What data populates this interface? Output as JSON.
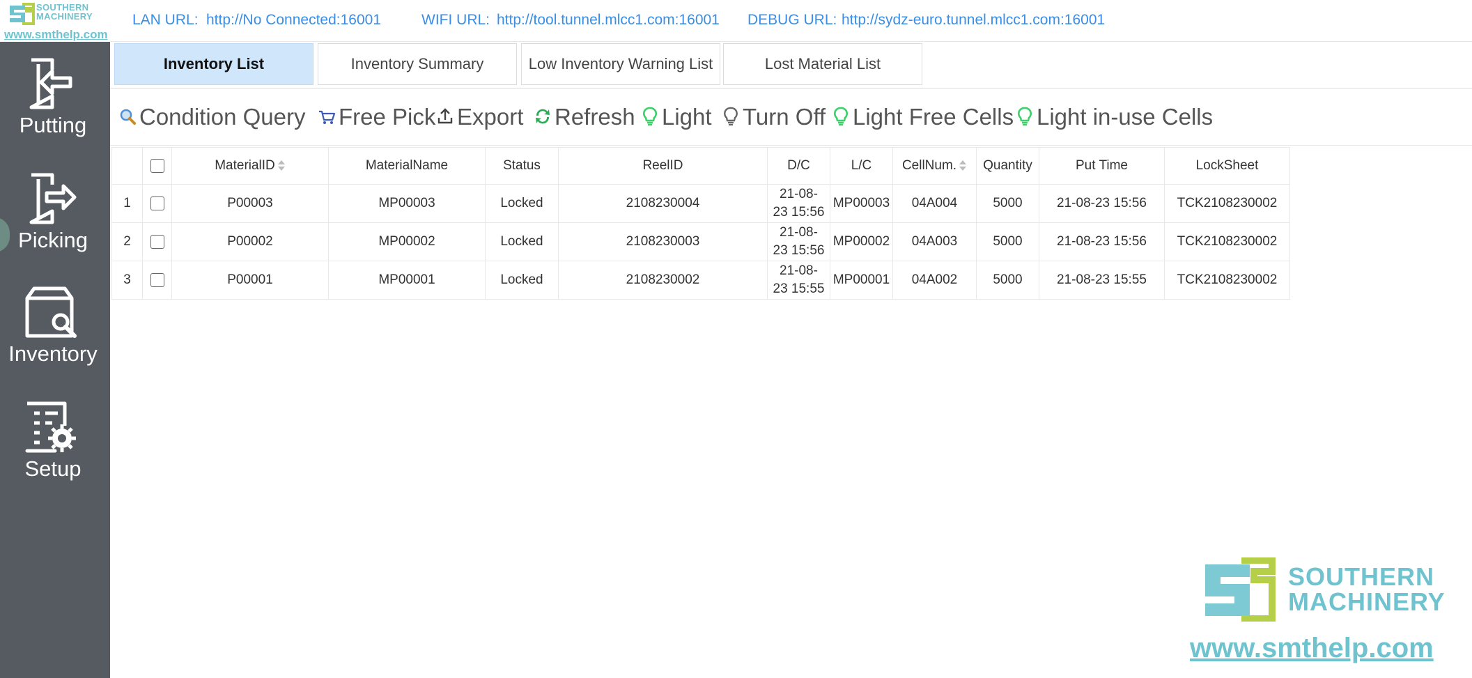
{
  "brand": {
    "name_line1": "SOUTHERN",
    "name_line2": "MACHINERY",
    "url": "www.smthelp.com",
    "color": "#6fc3cf"
  },
  "sidebar": {
    "background": "#555b61",
    "items": [
      {
        "label": "Putting",
        "icon": "putting-icon"
      },
      {
        "label": "Picking",
        "icon": "picking-icon"
      },
      {
        "label": "Inventory",
        "icon": "inventory-icon"
      },
      {
        "label": "Setup",
        "icon": "setup-icon"
      }
    ]
  },
  "urls": {
    "lan_label": "LAN URL:",
    "lan_value": "http://No Connected:16001",
    "wifi_label": "WIFI URL:",
    "wifi_value": "http://tool.tunnel.mlcc1.com:16001",
    "debug_label": "DEBUG URL:",
    "debug_value": "http://sydz-euro.tunnel.mlcc1.com:16001",
    "color": "#3a8ee6"
  },
  "tabs": [
    {
      "label": "Inventory List",
      "active": true
    },
    {
      "label": "Inventory Summary",
      "active": false
    },
    {
      "label": "Low Inventory Warning List",
      "active": false
    },
    {
      "label": "Lost Material List",
      "active": false
    }
  ],
  "toolbar": [
    {
      "label": "Condition Query",
      "icon": "search-icon"
    },
    {
      "label": "Free Pick",
      "icon": "cart-icon"
    },
    {
      "label": "Export",
      "icon": "upload-icon"
    },
    {
      "label": "Refresh",
      "icon": "refresh-icon"
    },
    {
      "label": "Light",
      "icon": "bulb-on-icon"
    },
    {
      "label": "Turn Off",
      "icon": "bulb-off-icon"
    },
    {
      "label": "Light Free Cells",
      "icon": "bulb-on-icon"
    },
    {
      "label": "Light in-use Cells",
      "icon": "bulb-on-icon"
    }
  ],
  "table": {
    "columns": [
      "",
      "",
      "MaterialID",
      "MaterialName",
      "Status",
      "ReelID",
      "D/C",
      "L/C",
      "CellNum.",
      "Quantity",
      "Put Time",
      "LockSheet"
    ],
    "rows": [
      {
        "no": "1",
        "material_id": "P00003",
        "material_name": "MP00003",
        "status": "Locked",
        "reel_id": "2108230004",
        "dc_line1": "21-08-",
        "dc_line2": "23 15:56",
        "lc": "MP00003",
        "cell": "04A004",
        "quantity": "5000",
        "put_time": "21-08-23 15:56",
        "lock_sheet": "TCK2108230002"
      },
      {
        "no": "2",
        "material_id": "P00002",
        "material_name": "MP00002",
        "status": "Locked",
        "reel_id": "2108230003",
        "dc_line1": "21-08-",
        "dc_line2": "23 15:56",
        "lc": "MP00002",
        "cell": "04A003",
        "quantity": "5000",
        "put_time": "21-08-23 15:56",
        "lock_sheet": "TCK2108230002"
      },
      {
        "no": "3",
        "material_id": "P00001",
        "material_name": "MP00001",
        "status": "Locked",
        "reel_id": "2108230002",
        "dc_line1": "21-08-",
        "dc_line2": "23 15:55",
        "lc": "MP00001",
        "cell": "04A002",
        "quantity": "5000",
        "put_time": "21-08-23 15:55",
        "lock_sheet": "TCK2108230002"
      }
    ]
  },
  "accent": {
    "tab_active_bg": "#cfe6fb",
    "bulb_green": "#3ccf6a",
    "refresh_green": "#2eaa55"
  }
}
